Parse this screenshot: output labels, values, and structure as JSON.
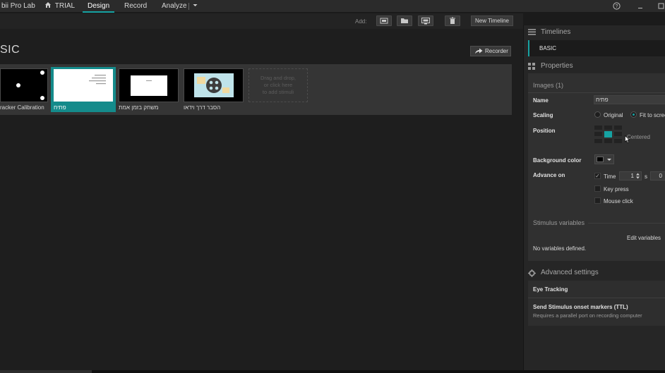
{
  "topbar": {
    "app_title": "bii Pro Lab",
    "project_name": "TRIAL",
    "tabs": [
      {
        "label": "Design",
        "active": true
      },
      {
        "label": "Record",
        "active": false
      },
      {
        "label": "Analyze",
        "active": false
      }
    ],
    "help_icon": "help-circle-icon",
    "minimize_icon": "minimize-icon",
    "maximize_icon": "maximize-icon"
  },
  "toolbar": {
    "add_label": "Add:",
    "icons": [
      "add-image-icon",
      "add-folder-icon",
      "add-screen-icon",
      "delete-icon"
    ],
    "new_timeline_label": "New Timeline"
  },
  "timeline": {
    "title": "SIC",
    "recorder_label": "Recorder",
    "stimuli": [
      {
        "label": "racker Calibration",
        "selected": false
      },
      {
        "label": "פתיח",
        "selected": true
      },
      {
        "label": "משחק בזמן אמת",
        "selected": false
      },
      {
        "label": "הסבר דרך וידאו",
        "selected": false
      }
    ],
    "drop_zone_lines": [
      "Drag and drop,",
      "or click here",
      "to add stimuli"
    ]
  },
  "panel": {
    "timelines_header": "Timelines",
    "timeline_entry": "BASIC",
    "properties_header": "Properties",
    "images_title": "Images (1)",
    "name_label": "Name",
    "name_value": "פתיח",
    "scaling_label": "Scaling",
    "scaling_options": [
      {
        "label": "Original",
        "selected": false
      },
      {
        "label": "Fit to scree",
        "selected": true
      }
    ],
    "position_label": "Position",
    "position_value": "Centered",
    "background_label": "Background color",
    "background_color": "#000000",
    "advance_label": "Advance on",
    "advance_time_label": "Time",
    "advance_time_checked": true,
    "advance_time_value": "1",
    "advance_time_unit": "s",
    "advance_time_ms": "0",
    "key_press_label": "Key press",
    "mouse_click_label": "Mouse click",
    "stimulus_variables_label": "Stimulus variables",
    "edit_variables_label": "Edit variables",
    "no_variables_text": "No variables defined.",
    "advanced_header": "Advanced settings",
    "eye_tracking_label": "Eye Tracking",
    "onset_markers_label": "Send Stimulus onset markers (TTL)",
    "onset_markers_hint": "Requires a parallel port on recording computer"
  },
  "colors": {
    "accent": "#16a3a3",
    "background": "#1e1e1e",
    "panel": "#262626"
  }
}
